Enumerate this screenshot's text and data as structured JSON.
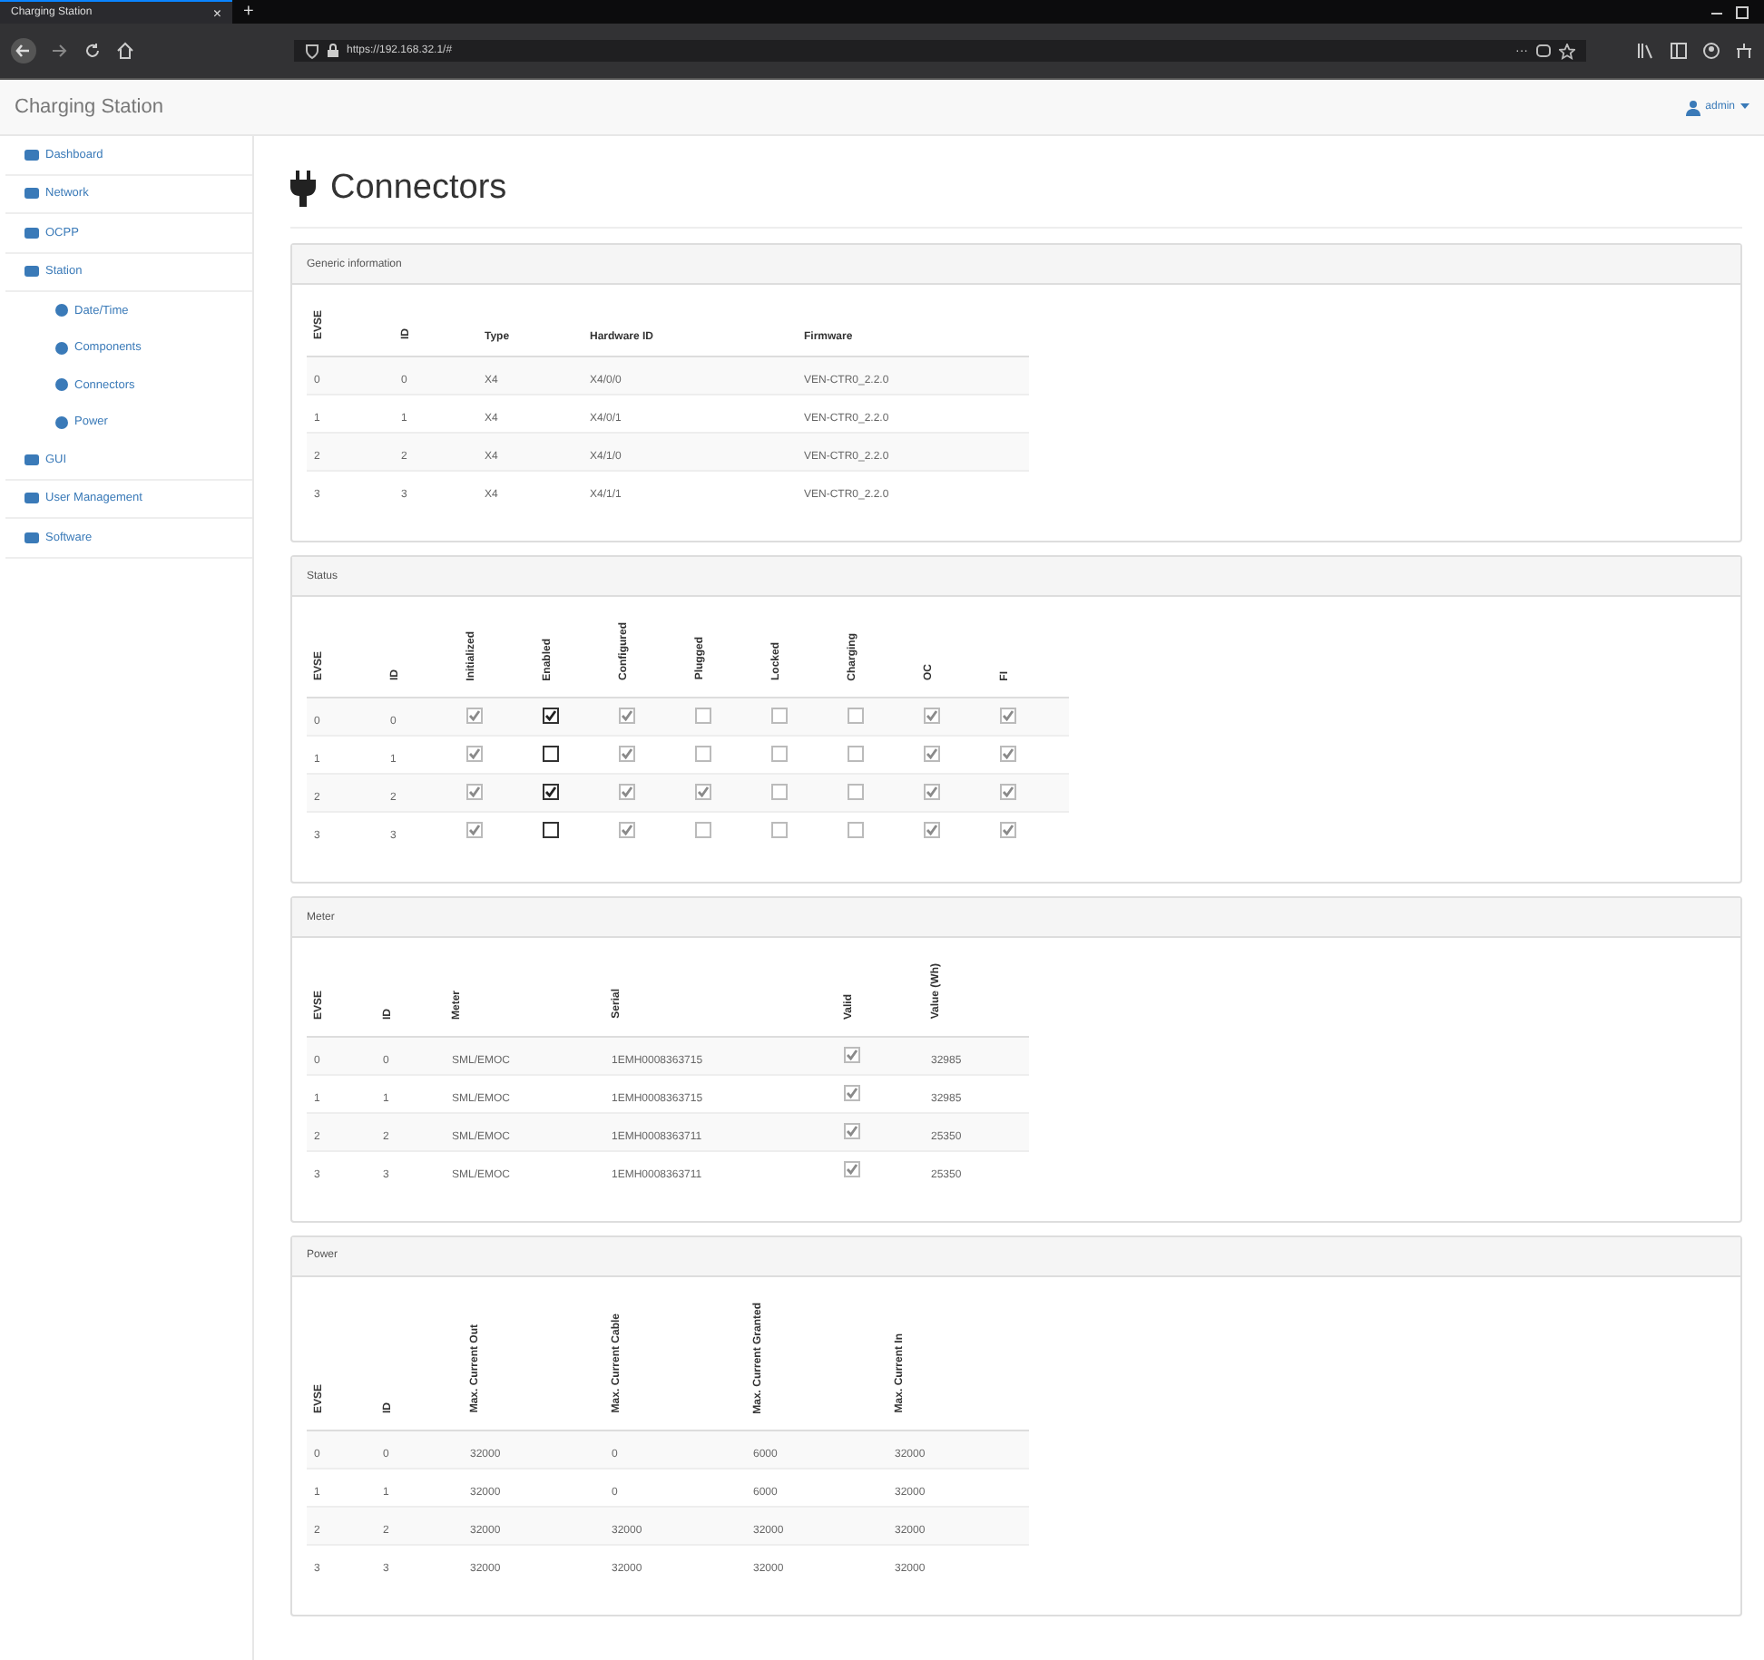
{
  "browser": {
    "tab_title": "Charging Station",
    "tab_close": "×",
    "new_tab": "+",
    "url": "https://192.168.32.1/#",
    "menu_dots": "···"
  },
  "navbar": {
    "brand": "Charging Station",
    "user": "admin"
  },
  "sidebar": {
    "items": [
      {
        "label": "Dashboard"
      },
      {
        "label": "Network"
      },
      {
        "label": "OCPP"
      },
      {
        "label": "Station",
        "children": [
          {
            "label": "Date/Time"
          },
          {
            "label": "Components"
          },
          {
            "label": "Connectors"
          },
          {
            "label": "Power"
          }
        ]
      },
      {
        "label": "GUI"
      },
      {
        "label": "User Management"
      },
      {
        "label": "Software"
      }
    ]
  },
  "page_title": "Connectors",
  "panels": [
    {
      "title": "Generic information",
      "columns": [
        {
          "label": "EVSE",
          "vertical": true
        },
        {
          "label": "ID",
          "vertical": true
        },
        {
          "label": "Type",
          "vertical": false
        },
        {
          "label": "Hardware ID",
          "vertical": false
        },
        {
          "label": "Firmware",
          "vertical": false
        }
      ],
      "rows": [
        [
          "0",
          "0",
          "X4",
          "X4/0/0",
          "VEN-CTR0_2.2.0"
        ],
        [
          "1",
          "1",
          "X4",
          "X4/0/1",
          "VEN-CTR0_2.2.0"
        ],
        [
          "2",
          "2",
          "X4",
          "X4/1/0",
          "VEN-CTR0_2.2.0"
        ],
        [
          "3",
          "3",
          "X4",
          "X4/1/1",
          "VEN-CTR0_2.2.0"
        ]
      ]
    },
    {
      "title": "Status",
      "columns": [
        {
          "label": "EVSE",
          "vertical": true
        },
        {
          "label": "ID",
          "vertical": true
        },
        {
          "label": "Initialized",
          "vertical": true
        },
        {
          "label": "Enabled",
          "vertical": true
        },
        {
          "label": "Configured",
          "vertical": true
        },
        {
          "label": "Plugged",
          "vertical": true
        },
        {
          "label": "Locked",
          "vertical": true
        },
        {
          "label": "Charging",
          "vertical": true
        },
        {
          "label": "OC",
          "vertical": true
        },
        {
          "label": "FI",
          "vertical": true
        }
      ],
      "rows": [
        [
          "0",
          "0",
          {
            "kind": "checkbox",
            "checked": true,
            "disabled": true
          },
          {
            "kind": "checkbox",
            "checked": true,
            "disabled": false
          },
          {
            "kind": "checkbox",
            "checked": true,
            "disabled": true
          },
          {
            "kind": "checkbox",
            "checked": false,
            "disabled": true
          },
          {
            "kind": "checkbox",
            "checked": false,
            "disabled": true
          },
          {
            "kind": "checkbox",
            "checked": false,
            "disabled": true
          },
          {
            "kind": "checkbox",
            "checked": true,
            "disabled": true
          },
          {
            "kind": "checkbox",
            "checked": true,
            "disabled": true
          }
        ],
        [
          "1",
          "1",
          {
            "kind": "checkbox",
            "checked": true,
            "disabled": true
          },
          {
            "kind": "checkbox",
            "checked": false,
            "disabled": false
          },
          {
            "kind": "checkbox",
            "checked": true,
            "disabled": true
          },
          {
            "kind": "checkbox",
            "checked": false,
            "disabled": true
          },
          {
            "kind": "checkbox",
            "checked": false,
            "disabled": true
          },
          {
            "kind": "checkbox",
            "checked": false,
            "disabled": true
          },
          {
            "kind": "checkbox",
            "checked": true,
            "disabled": true
          },
          {
            "kind": "checkbox",
            "checked": true,
            "disabled": true
          }
        ],
        [
          "2",
          "2",
          {
            "kind": "checkbox",
            "checked": true,
            "disabled": true
          },
          {
            "kind": "checkbox",
            "checked": true,
            "disabled": false
          },
          {
            "kind": "checkbox",
            "checked": true,
            "disabled": true
          },
          {
            "kind": "checkbox",
            "checked": true,
            "disabled": true
          },
          {
            "kind": "checkbox",
            "checked": false,
            "disabled": true
          },
          {
            "kind": "checkbox",
            "checked": false,
            "disabled": true
          },
          {
            "kind": "checkbox",
            "checked": true,
            "disabled": true
          },
          {
            "kind": "checkbox",
            "checked": true,
            "disabled": true
          }
        ],
        [
          "3",
          "3",
          {
            "kind": "checkbox",
            "checked": true,
            "disabled": true
          },
          {
            "kind": "checkbox",
            "checked": false,
            "disabled": false
          },
          {
            "kind": "checkbox",
            "checked": true,
            "disabled": true
          },
          {
            "kind": "checkbox",
            "checked": false,
            "disabled": true
          },
          {
            "kind": "checkbox",
            "checked": false,
            "disabled": true
          },
          {
            "kind": "checkbox",
            "checked": false,
            "disabled": true
          },
          {
            "kind": "checkbox",
            "checked": true,
            "disabled": true
          },
          {
            "kind": "checkbox",
            "checked": true,
            "disabled": true
          }
        ]
      ]
    },
    {
      "title": "Meter",
      "columns": [
        {
          "label": "EVSE",
          "vertical": true
        },
        {
          "label": "ID",
          "vertical": true
        },
        {
          "label": "Meter",
          "vertical": true
        },
        {
          "label": "Serial",
          "vertical": true
        },
        {
          "label": "Valid",
          "vertical": true
        },
        {
          "label": "Value (Wh)",
          "vertical": true
        }
      ],
      "rows": [
        [
          "0",
          "0",
          "SML/EMOC",
          "1EMH0008363715",
          {
            "kind": "checkbox",
            "checked": true,
            "disabled": true
          },
          "32985"
        ],
        [
          "1",
          "1",
          "SML/EMOC",
          "1EMH0008363715",
          {
            "kind": "checkbox",
            "checked": true,
            "disabled": true
          },
          "32985"
        ],
        [
          "2",
          "2",
          "SML/EMOC",
          "1EMH0008363711",
          {
            "kind": "checkbox",
            "checked": true,
            "disabled": true
          },
          "25350"
        ],
        [
          "3",
          "3",
          "SML/EMOC",
          "1EMH0008363711",
          {
            "kind": "checkbox",
            "checked": true,
            "disabled": true
          },
          "25350"
        ]
      ]
    },
    {
      "title": "Power",
      "columns": [
        {
          "label": "EVSE",
          "vertical": true
        },
        {
          "label": "ID",
          "vertical": true
        },
        {
          "label": "Max. Current Out",
          "vertical": true
        },
        {
          "label": "Max. Current Cable",
          "vertical": true
        },
        {
          "label": "Max. Current Granted",
          "vertical": true
        },
        {
          "label": "Max. Current In",
          "vertical": true
        }
      ],
      "rows": [
        [
          "0",
          "0",
          "32000",
          "0",
          "6000",
          "32000"
        ],
        [
          "1",
          "1",
          "32000",
          "0",
          "6000",
          "32000"
        ],
        [
          "2",
          "2",
          "32000",
          "32000",
          "32000",
          "32000"
        ],
        [
          "3",
          "3",
          "32000",
          "32000",
          "32000",
          "32000"
        ]
      ]
    }
  ]
}
